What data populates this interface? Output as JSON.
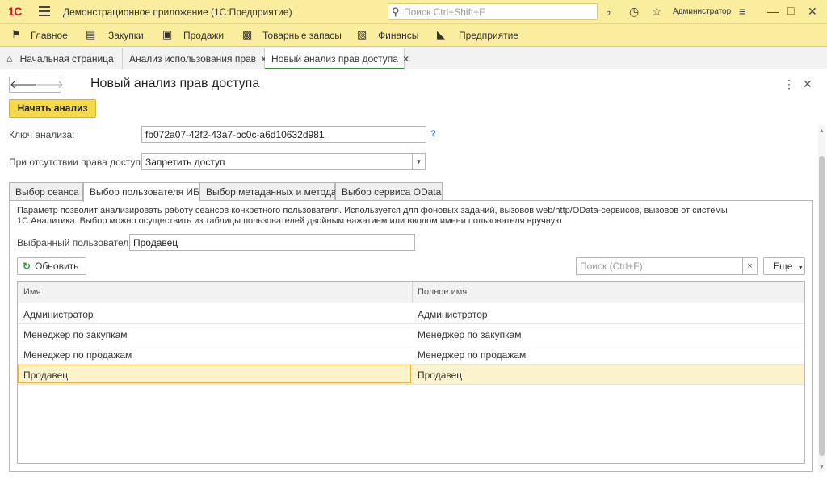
{
  "titlebar": {
    "logo": "1С",
    "app_title": "Демонстрационное приложение  (1С:Предприятие)",
    "search_placeholder": "Поиск Ctrl+Shift+F",
    "user": "Администратор",
    "icons": [
      "bell-icon",
      "history-icon",
      "star-icon",
      "settings-menu-icon",
      "minimize-icon",
      "maximize-icon",
      "close-icon"
    ]
  },
  "sections": [
    {
      "label": "Главное",
      "icon": "flag-icon"
    },
    {
      "label": "Закупки",
      "icon": "cart-icon"
    },
    {
      "label": "Продажи",
      "icon": "bag-icon"
    },
    {
      "label": "Товарные запасы",
      "icon": "boxes-icon"
    },
    {
      "label": "Финансы",
      "icon": "wallet-icon"
    },
    {
      "label": "Предприятие",
      "icon": "factory-icon"
    }
  ],
  "open_tabs": [
    {
      "label": "Начальная страница",
      "icon": "home-icon"
    },
    {
      "label": "Анализ использования прав"
    },
    {
      "label": "Новый анализ прав доступа"
    }
  ],
  "form": {
    "title": "Новый анализ прав доступа",
    "start_button": "Начать анализ",
    "key_label": "Ключ анализа:",
    "key_value": "fb072a07-42f2-43a7-bc0c-a6d10632d981",
    "help": "?",
    "no_access_label": "При отсутствии права доступа:",
    "no_access_value": "Запретить доступ"
  },
  "tabs": [
    "Выбор сеанса",
    "Выбор пользователя ИБ",
    "Выбор метаданных и метода",
    "Выбор сервиса OData"
  ],
  "active_tab": 1,
  "panel": {
    "description_line1": "Параметр позволит анализировать работу сеансов конкретного пользователя.  Используется для фоновых заданий, вызовов web/http/OData-сервисов, вызовов от системы",
    "description_line2": "1С:Аналитика. Выбор можно осуществить из таблицы пользователей двойным нажатием или вводом имени пользователя вручную",
    "selected_user_label": "Выбранный пользователь:",
    "selected_user_value": "Продавец",
    "refresh_button": "Обновить",
    "search_placeholder": "Поиск (Ctrl+F)",
    "search_clear": "×",
    "more_button": "Еще"
  },
  "table": {
    "columns": [
      "Имя",
      "Полное имя"
    ],
    "rows": [
      [
        "Администратор",
        "Администратор"
      ],
      [
        "Менеджер по закупкам",
        "Менеджер по закупкам"
      ],
      [
        "Менеджер по продажам",
        "Менеджер по продажам"
      ],
      [
        "Продавец",
        "Продавец"
      ]
    ],
    "selected_row": 3
  },
  "colors": {
    "titlebar": "#fbed9e",
    "accent_button": "#f5d94a",
    "selection": "#fcf3cd",
    "active_tab_underline": "#3a8f3a"
  }
}
